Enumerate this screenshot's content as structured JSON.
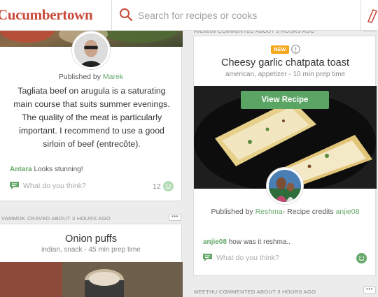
{
  "header": {
    "logo": "Cucumbertown",
    "search_placeholder": "Search for recipes or cooks"
  },
  "left_card_top": {
    "published_prefix": "Published by",
    "author": "Marek",
    "description": "Tagliata beef on arugula is a saturating main course that suits summer evenings. The quality of the meat is particularly important. I recommend to use a good sirloin of beef (entrecôte).",
    "comment_author": "Antara",
    "comment_text": "Looks stunning!",
    "comment_placeholder": "What do you think?",
    "like_count": "12"
  },
  "left_card_bottom": {
    "meta": "VAMMOK CRAVED ABOUT 3 HOURS AGO",
    "more_label": "•••",
    "title": "Onion puffs",
    "subtitle": "indian, snack - 45 min prep time"
  },
  "right_card": {
    "meta": "ANJIE08 COMMENTED ABOUT 3 HOURS AGO",
    "more_label": "•••",
    "badge": "NEW",
    "info_label": "!",
    "title": "Cheesy garlic chatpata toast",
    "subtitle": "american, appetizer - 10 min prep time",
    "view_button": "View Recipe",
    "published_prefix": "Published by",
    "author": "Reshma",
    "credits_prefix": "- Recipe credits",
    "credits_author": "anjie08",
    "comment_author": "anjie08",
    "comment_text": "how was it reshma..",
    "comment_placeholder": "What do you think?"
  },
  "right_bottom": {
    "meta": "MEETHU COMMENTED ABOUT 3 HOURS AGO",
    "more_label": "•••"
  },
  "colors": {
    "brand": "#c84a3a",
    "accent_green": "#67a86b",
    "button_green": "#5aa464",
    "badge_orange": "#f4a81f"
  }
}
